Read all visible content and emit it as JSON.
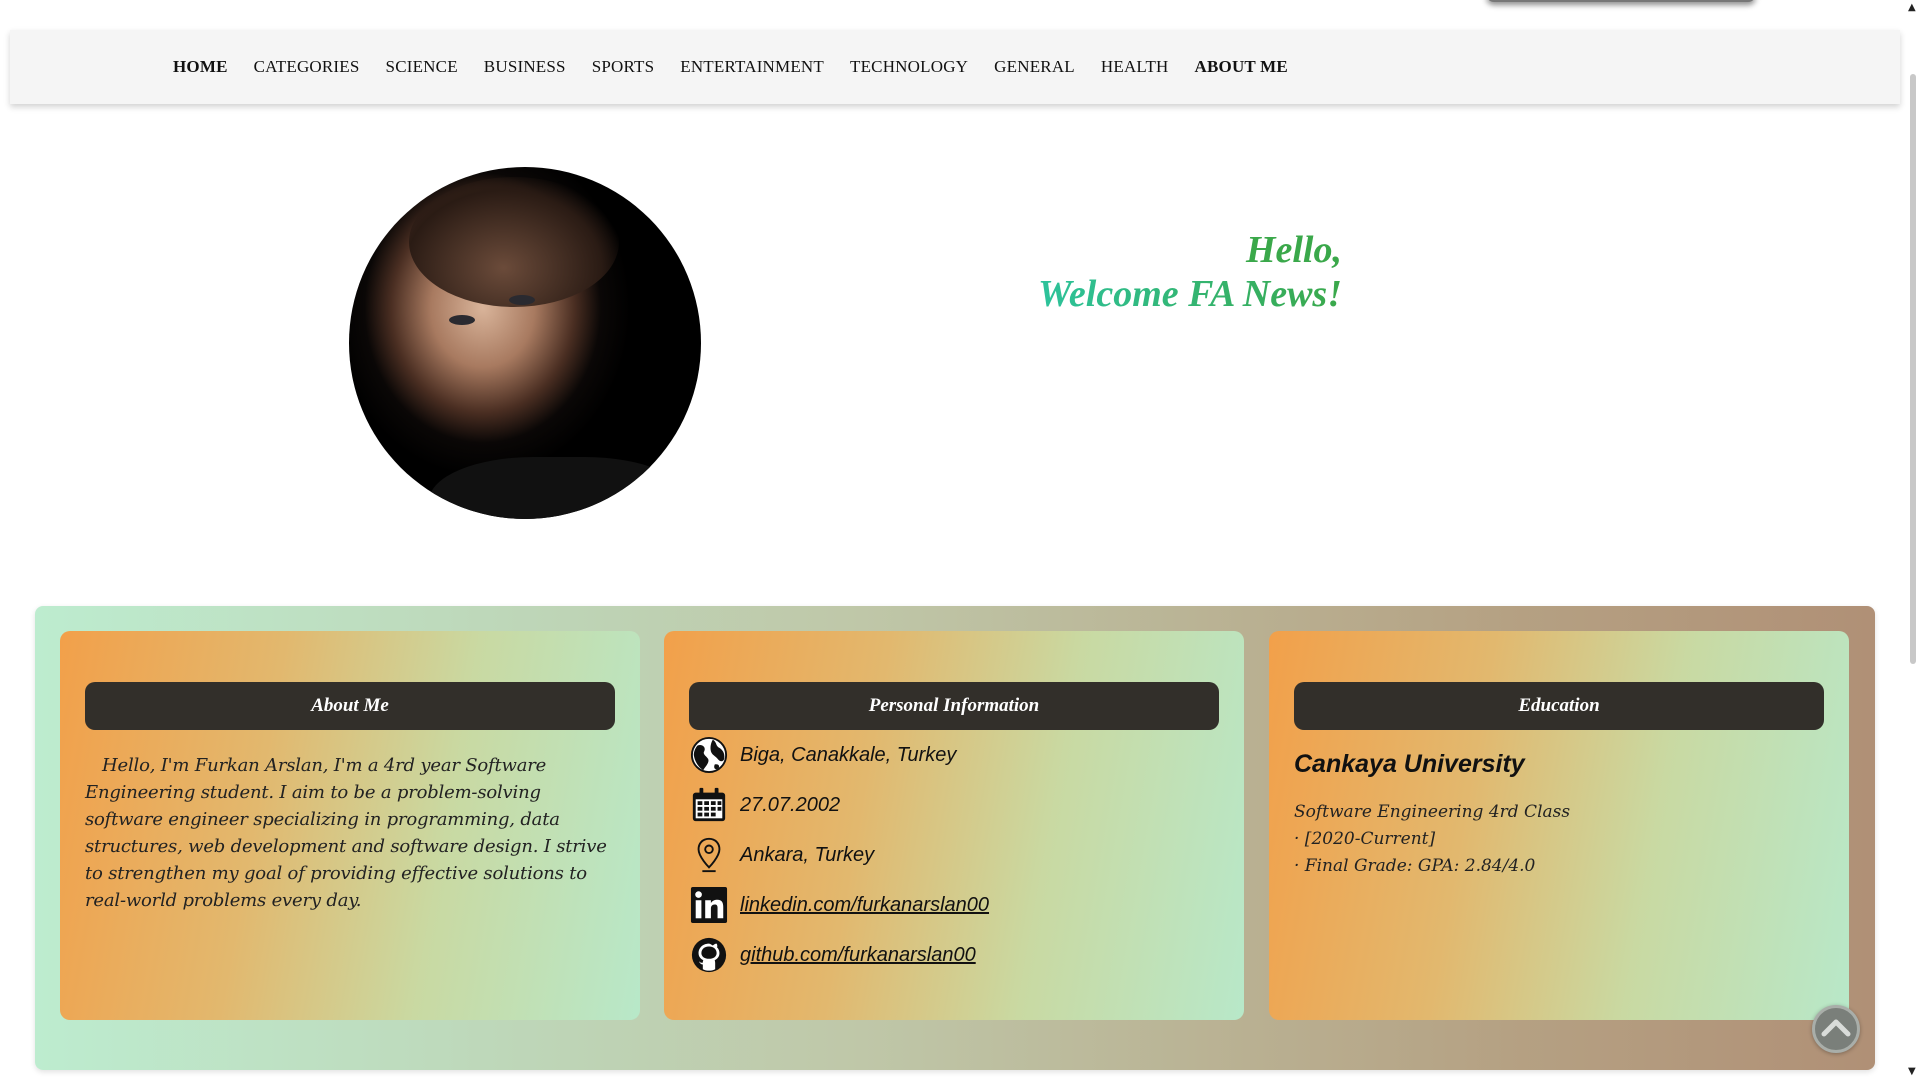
{
  "nav": {
    "items": [
      {
        "label": "HOME",
        "bold": true
      },
      {
        "label": "CATEGORIES",
        "bold": false
      },
      {
        "label": "SCIENCE",
        "bold": false
      },
      {
        "label": "BUSINESS",
        "bold": false
      },
      {
        "label": "SPORTS",
        "bold": false
      },
      {
        "label": "ENTERTAINMENT",
        "bold": false
      },
      {
        "label": "TECHNOLOGY",
        "bold": false
      },
      {
        "label": "GENERAL",
        "bold": false
      },
      {
        "label": "HEALTH",
        "bold": false
      },
      {
        "label": "ABOUT ME",
        "bold": true
      }
    ]
  },
  "hero": {
    "line1": "Hello,",
    "line2": "Welcome FA News!"
  },
  "about": {
    "header": "About Me",
    "text": "Hello, I'm Furkan Arslan, I'm a 4rd year Software Engineering student. I aim to be a problem-solving software engineer specializing in programming, data structures, web development and software design. I strive to strengthen my goal of providing effective solutions to real-world problems every day."
  },
  "personal": {
    "header": "Personal Information",
    "birthplace": "Biga, Canakkale, Turkey",
    "birthdate": "27.07.2002",
    "location": "Ankara, Turkey",
    "linkedin": "linkedin.com/furkanarslan00",
    "github": "github.com/furkanarslan00"
  },
  "education": {
    "header": "Education",
    "school": "Cankaya University",
    "program": "Software Engineering 4rd Class",
    "period": "· [2020-Current]",
    "grade": "· Final Grade: GPA: 2.84/4.0"
  },
  "icons": {
    "globe": "globe-icon",
    "calendar": "calendar-icon",
    "location": "map-pin-icon",
    "linkedin": "linkedin-icon",
    "github": "github-icon",
    "back_to_top": "chevron-up-icon"
  },
  "colors": {
    "accent_green": "#3aa84a",
    "card_header": "#322f2a",
    "card_orange": "#f2a04a",
    "card_mint": "#b8e8c9"
  }
}
